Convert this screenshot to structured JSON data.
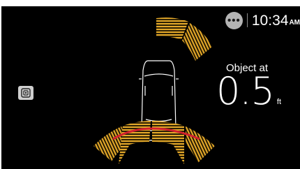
{
  "status_bar": {
    "more_label": "•••",
    "time": "10:34",
    "ampm": "AM"
  },
  "side_button": {
    "icon": "parking-camera-icon"
  },
  "readout": {
    "label": "Object at",
    "distance": "0.5",
    "unit": "ft"
  },
  "sensor_zones": {
    "front": [
      "far",
      "far",
      "off",
      "off"
    ],
    "rear": [
      "near",
      "near",
      "near",
      "near"
    ]
  },
  "colors": {
    "background": "#000000",
    "sensor_stripe": "#e3a82a",
    "near_edge": "#d2202e",
    "car_outline": "#ffffff"
  }
}
